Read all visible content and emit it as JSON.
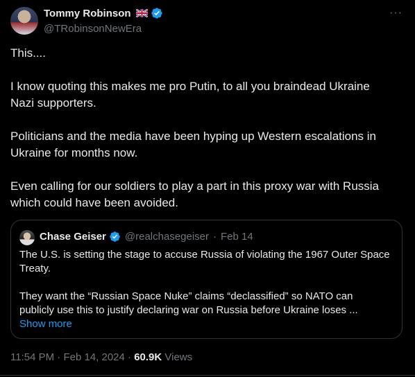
{
  "author": {
    "name": "Tommy Robinson",
    "flag": "uk-flag-icon",
    "verified": "verified-badge-icon",
    "handle": "@TRobinsonNewEra"
  },
  "more_menu": "···",
  "tweet_text": "This....\n\nI know quoting this makes me pro Putin, to all you braindead Ukraine\nNazi supporters.\n\nPoliticians and the media have been hyping up Western escalations in\nUkraine for months now.\n\nEven calling for our soldiers to play a part in this proxy war with Russia\nwhich could have been avoided.",
  "quoted": {
    "name": "Chase Geiser",
    "handle": "@realchasegeiser",
    "separator": "·",
    "date": "Feb 14",
    "text": "The U.S. is setting the stage to accuse Russia of violating the 1967 Outer Space\nTreaty.\n\nThey want the “Russian Space Nuke” claims “declassified” so NATO can\npublicly use this to justify declaring war on Russia before Ukraine loses ...",
    "show_more": "Show more"
  },
  "meta": {
    "time": "11:54 PM",
    "separator": "·",
    "date": "Feb 14, 2024",
    "views_count": "60.9K",
    "views_label": "Views"
  },
  "colors": {
    "background": "#000000",
    "text": "#e7e9ea",
    "secondary": "#71767b",
    "link": "#1d9bf0",
    "border": "#2f3336"
  }
}
